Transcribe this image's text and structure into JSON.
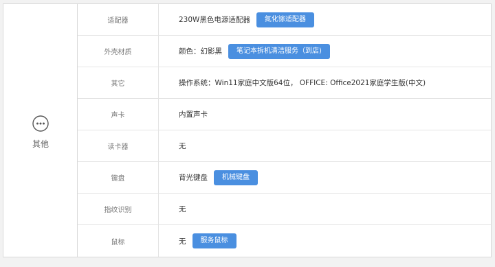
{
  "section": {
    "label": "其他",
    "icon": "more-dots-icon"
  },
  "rows": [
    {
      "label": "适配器",
      "value": "230W黑色电源适配器",
      "button": "氮化镓适配器"
    },
    {
      "label": "外壳材质",
      "value": "颜色：幻影黑",
      "button": "笔记本拆机清洁服务（到店)"
    },
    {
      "label": "其它",
      "value": "操作系统：Win11家庭中文版64位， OFFICE: Office2021家庭学生版(中文)",
      "button": ""
    },
    {
      "label": "声卡",
      "value": "内置声卡",
      "button": ""
    },
    {
      "label": "读卡器",
      "value": "无",
      "button": ""
    },
    {
      "label": "键盘",
      "value": "背光键盘",
      "button": "机械键盘"
    },
    {
      "label": "指纹识别",
      "value": "无",
      "button": ""
    },
    {
      "label": "鼠标",
      "value": "无",
      "button": "服务鼠标"
    }
  ],
  "colors": {
    "button": "#4a8fe0",
    "border": "#e4e4e4",
    "label_text": "#777777"
  }
}
